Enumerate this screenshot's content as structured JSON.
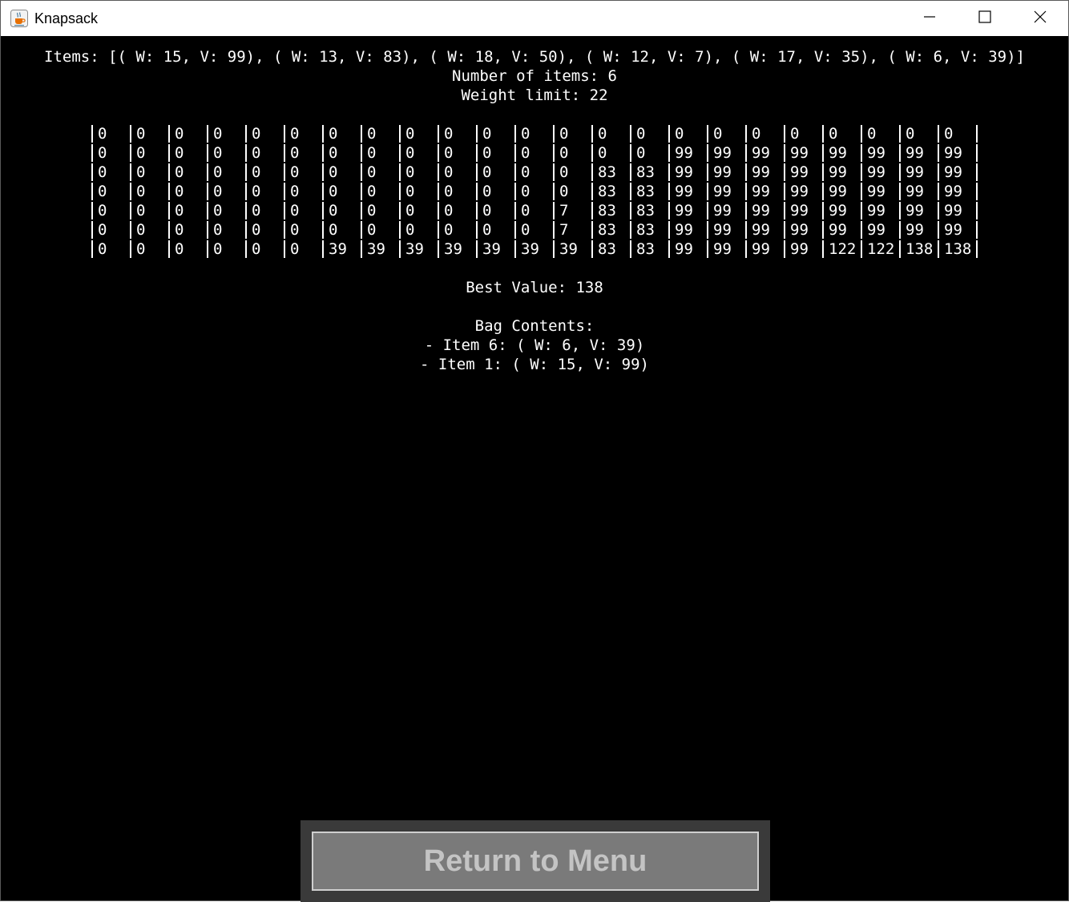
{
  "window": {
    "title": "Knapsack",
    "app_icon": "java-coffee-icon",
    "controls": {
      "minimize_icon": "minimize-icon",
      "maximize_icon": "maximize-icon",
      "close_icon": "close-icon"
    }
  },
  "console": {
    "items_line": "Items: [( W: 15, V: 99), ( W: 13, V: 83), ( W: 18, V: 50), ( W: 12, V: 7), ( W: 17, V: 35), ( W: 6, V: 39)]",
    "number_of_items": "Number of items: 6",
    "weight_limit": "Weight limit: 22",
    "table": [
      [
        "0",
        "0",
        "0",
        "0",
        "0",
        "0",
        "0",
        "0",
        "0",
        "0",
        "0",
        "0",
        "0",
        "0",
        "0",
        "0",
        "0",
        "0",
        "0",
        "0",
        "0",
        "0",
        "0"
      ],
      [
        "0",
        "0",
        "0",
        "0",
        "0",
        "0",
        "0",
        "0",
        "0",
        "0",
        "0",
        "0",
        "0",
        "0",
        "0",
        "99",
        "99",
        "99",
        "99",
        "99",
        "99",
        "99",
        "99"
      ],
      [
        "0",
        "0",
        "0",
        "0",
        "0",
        "0",
        "0",
        "0",
        "0",
        "0",
        "0",
        "0",
        "0",
        "83",
        "83",
        "99",
        "99",
        "99",
        "99",
        "99",
        "99",
        "99",
        "99"
      ],
      [
        "0",
        "0",
        "0",
        "0",
        "0",
        "0",
        "0",
        "0",
        "0",
        "0",
        "0",
        "0",
        "0",
        "83",
        "83",
        "99",
        "99",
        "99",
        "99",
        "99",
        "99",
        "99",
        "99"
      ],
      [
        "0",
        "0",
        "0",
        "0",
        "0",
        "0",
        "0",
        "0",
        "0",
        "0",
        "0",
        "0",
        "7",
        "83",
        "83",
        "99",
        "99",
        "99",
        "99",
        "99",
        "99",
        "99",
        "99"
      ],
      [
        "0",
        "0",
        "0",
        "0",
        "0",
        "0",
        "0",
        "0",
        "0",
        "0",
        "0",
        "0",
        "7",
        "83",
        "83",
        "99",
        "99",
        "99",
        "99",
        "99",
        "99",
        "99",
        "99"
      ],
      [
        "0",
        "0",
        "0",
        "0",
        "0",
        "0",
        "39",
        "39",
        "39",
        "39",
        "39",
        "39",
        "39",
        "83",
        "83",
        "99",
        "99",
        "99",
        "99",
        "122",
        "122",
        "138",
        "138"
      ]
    ],
    "best_value": "Best Value: 138",
    "bag_contents_header": "Bag Contents:",
    "bag_items": [
      "- Item 6: ( W: 6, V: 39)",
      "- Item 1: ( W: 15, V: 99)"
    ]
  },
  "footer": {
    "return_button_label": "Return to Menu"
  },
  "colors": {
    "background": "#000000",
    "text": "#ffffff",
    "panel": "#3a3a3a",
    "button_fill": "#7a7a7a",
    "button_text": "#c4c4c4"
  }
}
